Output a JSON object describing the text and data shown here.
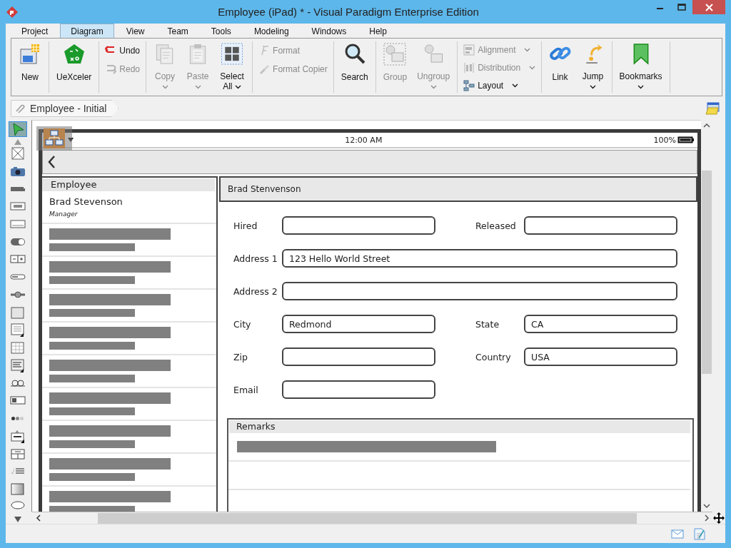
{
  "window": {
    "title": "Employee (iPad) * - Visual Paradigm Enterprise Edition"
  },
  "menu_tabs": [
    {
      "label": "Project",
      "selected": false
    },
    {
      "label": "Diagram",
      "selected": true
    },
    {
      "label": "View",
      "selected": false
    },
    {
      "label": "Team",
      "selected": false
    },
    {
      "label": "Tools",
      "selected": false
    },
    {
      "label": "Modeling",
      "selected": false
    },
    {
      "label": "Windows",
      "selected": false
    },
    {
      "label": "Help",
      "selected": false
    }
  ],
  "ribbon": {
    "groups": [
      {
        "items": [
          {
            "label": "New",
            "kind": "large",
            "disabled": false,
            "dropdown": false
          }
        ]
      },
      {
        "items": [
          {
            "label": "UeXceler",
            "kind": "large",
            "disabled": false,
            "dropdown": false
          }
        ]
      },
      {
        "items": [
          {
            "label": "Undo",
            "kind": "small",
            "disabled": false,
            "dropdown": false
          },
          {
            "label": "Redo",
            "kind": "small",
            "disabled": true,
            "dropdown": false
          }
        ]
      },
      {
        "items": [
          {
            "label": "Copy",
            "kind": "large",
            "disabled": true,
            "dropdown": true
          },
          {
            "label": "Paste",
            "kind": "large",
            "disabled": true,
            "dropdown": true
          },
          {
            "label": "Select All",
            "kind": "large",
            "disabled": false,
            "dropdown": true
          }
        ]
      },
      {
        "items": [
          {
            "label": "Format",
            "kind": "small",
            "disabled": true,
            "dropdown": false
          },
          {
            "label": "Format Copier",
            "kind": "small",
            "disabled": true,
            "dropdown": false
          }
        ]
      },
      {
        "items": [
          {
            "label": "Search",
            "kind": "large",
            "disabled": false,
            "dropdown": false
          }
        ]
      },
      {
        "items": [
          {
            "label": "Group",
            "kind": "large",
            "disabled": true,
            "dropdown": false
          },
          {
            "label": "Ungroup",
            "kind": "large",
            "disabled": true,
            "dropdown": true
          }
        ]
      },
      {
        "items": [
          {
            "label": "Alignment",
            "kind": "small",
            "disabled": true,
            "dropdown": true
          },
          {
            "label": "Distribution",
            "kind": "small",
            "disabled": true,
            "dropdown": true
          },
          {
            "label": "Layout",
            "kind": "small",
            "disabled": false,
            "dropdown": true
          }
        ]
      },
      {
        "items": [
          {
            "label": "Link",
            "kind": "large",
            "disabled": false,
            "dropdown": false
          },
          {
            "label": "Jump",
            "kind": "large",
            "disabled": false,
            "dropdown": true
          }
        ]
      },
      {
        "items": [
          {
            "label": "Bookmarks",
            "kind": "large",
            "disabled": false,
            "dropdown": true
          }
        ]
      }
    ]
  },
  "breadcrumb": {
    "label": "Employee - Initial"
  },
  "palette": [
    {
      "selected": true
    },
    {
      "selected": false
    },
    {
      "selected": false
    },
    {
      "selected": false
    },
    {
      "selected": false
    },
    {
      "selected": false
    },
    {
      "selected": false
    },
    {
      "selected": false
    },
    {
      "selected": false
    },
    {
      "selected": false
    },
    {
      "selected": false
    },
    {
      "selected": false
    },
    {
      "selected": false
    },
    {
      "selected": false
    },
    {
      "selected": false
    },
    {
      "selected": false
    },
    {
      "selected": false
    },
    {
      "selected": false
    },
    {
      "selected": false
    },
    {
      "selected": false
    },
    {
      "selected": false
    },
    {
      "selected": false
    }
  ],
  "mockup": {
    "status_bar": {
      "time": "12:00 AM",
      "battery": "100%"
    },
    "list": {
      "header": "Employee",
      "items": [
        {
          "kind": "text",
          "title": "Brad Stevenson",
          "subtitle": "Manager"
        },
        {
          "kind": "placeholder"
        },
        {
          "kind": "placeholder"
        },
        {
          "kind": "placeholder"
        },
        {
          "kind": "placeholder"
        },
        {
          "kind": "placeholder"
        },
        {
          "kind": "placeholder"
        },
        {
          "kind": "placeholder"
        },
        {
          "kind": "placeholder"
        },
        {
          "kind": "placeholder"
        }
      ]
    },
    "detail": {
      "header": "Brad Stenvenson",
      "rows": [
        {
          "kind": "pair",
          "fields": [
            {
              "label": "Hired"
            },
            {
              "label": "Released"
            }
          ]
        },
        {
          "kind": "wide",
          "fields": [
            {
              "label": "Address 1",
              "value": "123 Hello World Street"
            }
          ]
        },
        {
          "kind": "wide",
          "fields": [
            {
              "label": "Address 2"
            }
          ]
        },
        {
          "kind": "pair",
          "fields": [
            {
              "label": "City",
              "value": "Redmond"
            },
            {
              "label": "State",
              "value": "CA"
            }
          ]
        },
        {
          "kind": "pair",
          "fields": [
            {
              "label": "Zip"
            },
            {
              "label": "Country",
              "value": "USA"
            }
          ]
        },
        {
          "kind": "single",
          "fields": [
            {
              "label": "Email"
            }
          ]
        }
      ],
      "remarks": {
        "header": "Remarks",
        "rows": [
          {
            "kind": "placeholder"
          },
          {
            "kind": "empty"
          },
          {
            "kind": "empty"
          }
        ]
      }
    }
  }
}
